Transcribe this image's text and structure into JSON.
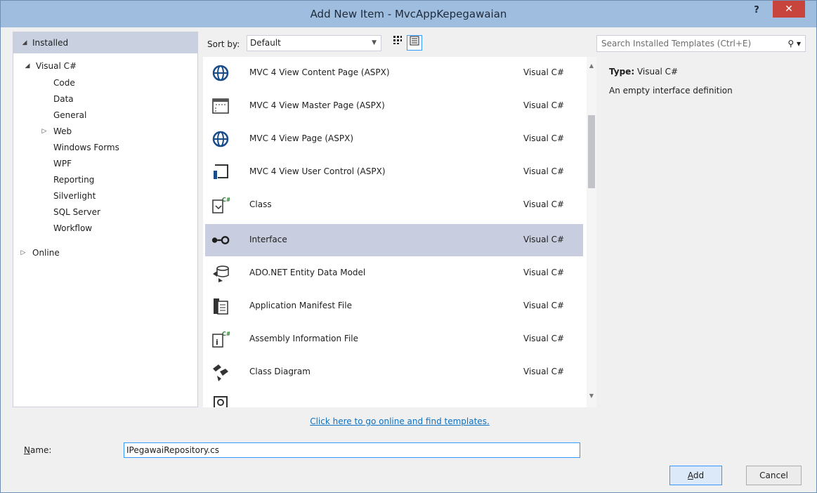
{
  "window": {
    "title": "Add New Item - MvcAppKepegawaian",
    "help": "?",
    "close": "✕"
  },
  "tree": {
    "installed": "Installed",
    "visual_csharp": "Visual C#",
    "items": [
      "Code",
      "Data",
      "General",
      "Web",
      "Windows Forms",
      "WPF",
      "Reporting",
      "Silverlight",
      "SQL Server",
      "Workflow"
    ],
    "online": "Online"
  },
  "toolbar": {
    "sort_label": "Sort by:",
    "sort_value": "Default"
  },
  "search": {
    "placeholder": "Search Installed Templates (Ctrl+E)"
  },
  "templates": [
    {
      "name": "MVC 4 View Content Page (ASPX)",
      "lang": "Visual C#",
      "icon": "globe-icon"
    },
    {
      "name": "MVC 4 View Master Page (ASPX)",
      "lang": "Visual C#",
      "icon": "master-page-icon"
    },
    {
      "name": "MVC 4 View Page (ASPX)",
      "lang": "Visual C#",
      "icon": "globe-icon"
    },
    {
      "name": "MVC 4 View User Control (ASPX)",
      "lang": "Visual C#",
      "icon": "user-control-icon"
    },
    {
      "name": "Class",
      "lang": "Visual C#",
      "icon": "class-icon"
    },
    {
      "name": "Interface",
      "lang": "Visual C#",
      "icon": "interface-icon"
    },
    {
      "name": "ADO.NET Entity Data Model",
      "lang": "Visual C#",
      "icon": "entity-model-icon"
    },
    {
      "name": "Application Manifest File",
      "lang": "Visual C#",
      "icon": "manifest-icon"
    },
    {
      "name": "Assembly Information File",
      "lang": "Visual C#",
      "icon": "assembly-info-icon"
    },
    {
      "name": "Class Diagram",
      "lang": "Visual C#",
      "icon": "class-diagram-icon"
    }
  ],
  "online_link": "Click here to go online and find templates.",
  "details": {
    "type_label": "Type:",
    "type_value": "Visual C#",
    "description": "An empty interface definition"
  },
  "name_field": {
    "label": "Name:",
    "value": "IPegawaiRepository.cs"
  },
  "buttons": {
    "add": "Add",
    "cancel": "Cancel"
  },
  "colors": {
    "titlebar": "#9fbedf",
    "close": "#c7453c",
    "selection": "#c9cde0",
    "link": "#0e70c0",
    "focus": "#3399ff"
  }
}
